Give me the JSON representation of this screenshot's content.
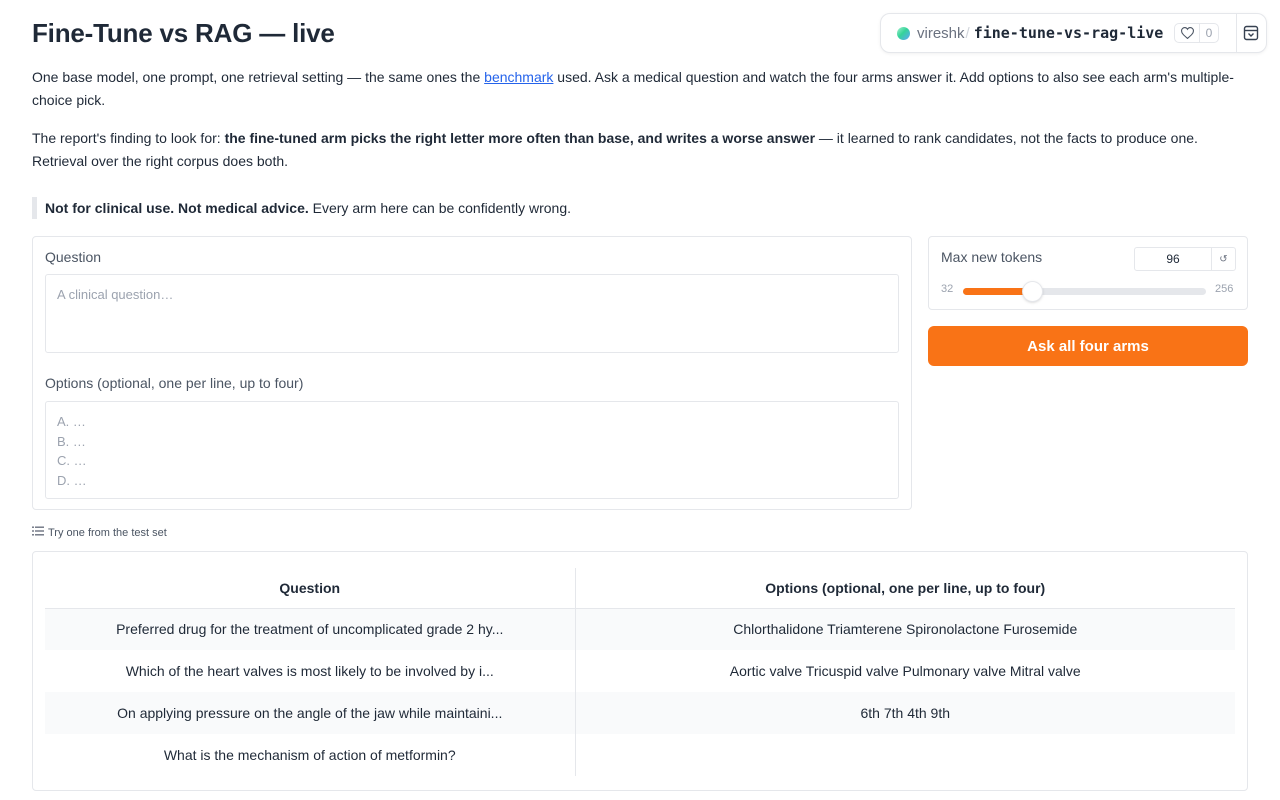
{
  "header": {
    "title": "Fine-Tune vs RAG — live"
  },
  "space_badge": {
    "owner": "vireshk",
    "separator": "/",
    "space_name": "fine-tune-vs-rag-live",
    "likes": "0"
  },
  "intro": {
    "p1_before": "One base model, one prompt, one retrieval setting — the same ones the ",
    "p1_link": "benchmark",
    "p1_after": " used. Ask a medical question and watch the four arms answer it. Add options to also see each arm's multiple-choice pick.",
    "p2_before": "The report's finding to look for: ",
    "p2_bold": "the fine-tuned arm picks the right letter more often than base, and writes a worse answer",
    "p2_after": " — it learned to rank candidates, not the facts to produce one. Retrieval over the right corpus does both."
  },
  "disclaimer": {
    "bold": "Not for clinical use. Not medical advice.",
    "rest": " Every arm here can be confidently wrong."
  },
  "question_field": {
    "label": "Question",
    "placeholder": "A clinical question…",
    "value": ""
  },
  "options_field": {
    "label": "Options (optional, one per line, up to four)",
    "placeholder": "A. …\nB. …\nC. …\nD. …",
    "value": ""
  },
  "max_tokens": {
    "label": "Max new tokens",
    "value": 96,
    "value_text": "96",
    "min": 32,
    "min_text": "32",
    "max": 256,
    "max_text": "256",
    "reset_symbol": "↺"
  },
  "ask_button": {
    "label": "Ask all four arms"
  },
  "examples": {
    "label": "Try one from the test set",
    "columns": [
      "Question",
      "Options (optional, one per line, up to four)"
    ],
    "rows": [
      {
        "question": "Preferred drug for the treatment of uncomplicated grade 2 hy...",
        "options": "Chlorthalidone Triamterene Spironolactone Furosemide"
      },
      {
        "question": "Which of the heart valves is most likely to be involved by i...",
        "options": "Aortic valve Tricuspid valve Pulmonary valve Mitral valve"
      },
      {
        "question": "On applying pressure on the angle of the jaw while maintaini...",
        "options": "6th 7th 4th 9th"
      },
      {
        "question": "What is the mechanism of action of metformin?",
        "options": ""
      }
    ]
  },
  "colors": {
    "accent": "#f97316",
    "link": "#2563eb"
  }
}
